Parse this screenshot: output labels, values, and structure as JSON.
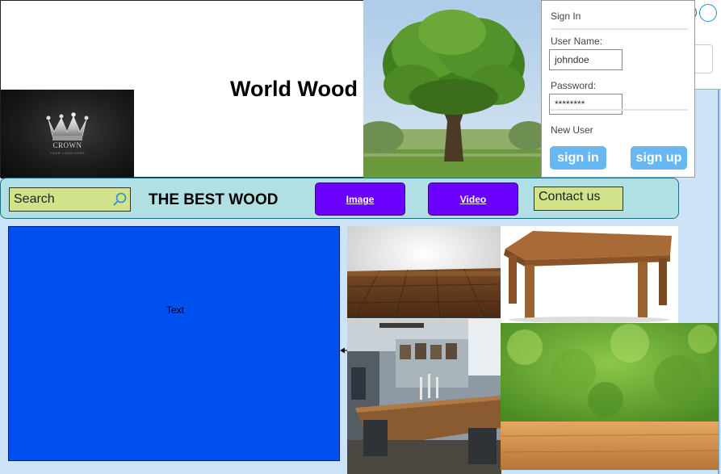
{
  "header": {
    "site_title": "World Wood",
    "logo": {
      "text": "CROWN",
      "subtext": "YOUR LOGO HERE",
      "icon": "crown-icon"
    }
  },
  "signin": {
    "title": "Sign In",
    "username_label": "User Name:",
    "username_value": "johndoe",
    "password_label": "Password:",
    "password_value": "********",
    "new_user_label": "New User",
    "signin_button": "sign in",
    "signup_button": "sign up"
  },
  "nav": {
    "search_placeholder": "Search",
    "search_icon": "search-icon",
    "tagline": "THE BEST WOOD",
    "image_button": "Image",
    "video_button": "Video",
    "contact_button": "Contact us"
  },
  "content": {
    "text_block_label": "Text"
  },
  "colors": {
    "nav_background": "#b0e0e3",
    "search_background": "#d0e38a",
    "nav_button": "#6a00ff",
    "text_block": "#0050ef",
    "signin_button": "#66b7f2",
    "page_background": "#cde3f7"
  }
}
